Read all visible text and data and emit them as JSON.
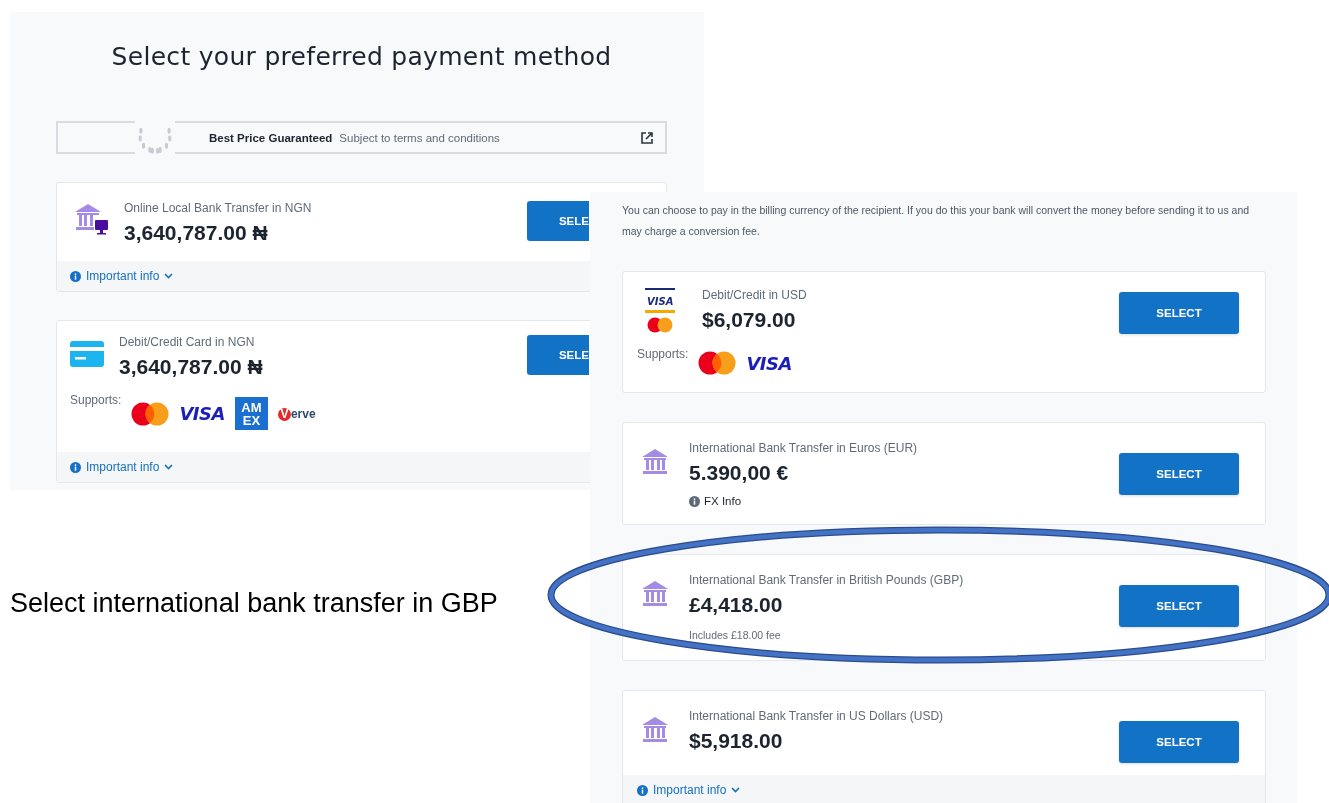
{
  "screens": [
    {
      "title": "Select your preferred payment method",
      "banner": {
        "title": "Best Price Guaranteed",
        "subtitle": "Subject to terms and conditions"
      },
      "methods": [
        {
          "kind": "bank-screen",
          "name": "Online Local Bank Transfer in NGN",
          "amount": "3,640,787.00 ₦",
          "select_label": "SELE",
          "important_info": "Important info"
        },
        {
          "kind": "card",
          "name": "Debit/Credit Card in NGN",
          "amount": "3,640,787.00 ₦",
          "select_label": "SELE",
          "supports_label": "Supports:",
          "supports": [
            {
              "kind": "mastercard"
            },
            {
              "kind": "visa",
              "label": "VISA"
            },
            {
              "kind": "amex",
              "lines": [
                "AM",
                "EX"
              ]
            },
            {
              "kind": "verve",
              "label": "Verve"
            }
          ],
          "important_info": "Important info"
        }
      ]
    },
    {
      "notice": "You can choose to pay in the billing currency of the recipient. If you do this your bank will convert the money before sending it to us and may charge a conversion fee.",
      "methods": [
        {
          "kind": "card-brands",
          "brand_label": "VISA",
          "name": "Debit/Credit in USD",
          "amount": "$6,079.00",
          "select_label": "SELECT",
          "supports_label": "Supports:",
          "supports": [
            {
              "kind": "mastercard"
            },
            {
              "kind": "visa",
              "label": "VISA"
            }
          ],
          "highlighted": false
        },
        {
          "kind": "bank",
          "name": "International Bank Transfer in Euros (EUR)",
          "amount": "5.390,00 €",
          "select_label": "SELECT",
          "fx_info": "FX Info",
          "highlighted": false
        },
        {
          "kind": "bank",
          "name": "International Bank Transfer in British Pounds (GBP)",
          "amount": "£4,418.00",
          "select_label": "SELECT",
          "note": "Includes £18.00 fee",
          "highlighted": true
        },
        {
          "kind": "bank",
          "name": "International Bank Transfer in US Dollars (USD)",
          "amount": "$5,918.00",
          "select_label": "SELECT",
          "important_info": "Important info",
          "highlighted": false
        }
      ]
    }
  ],
  "annotation": {
    "text": "Select international bank transfer in GBP"
  }
}
